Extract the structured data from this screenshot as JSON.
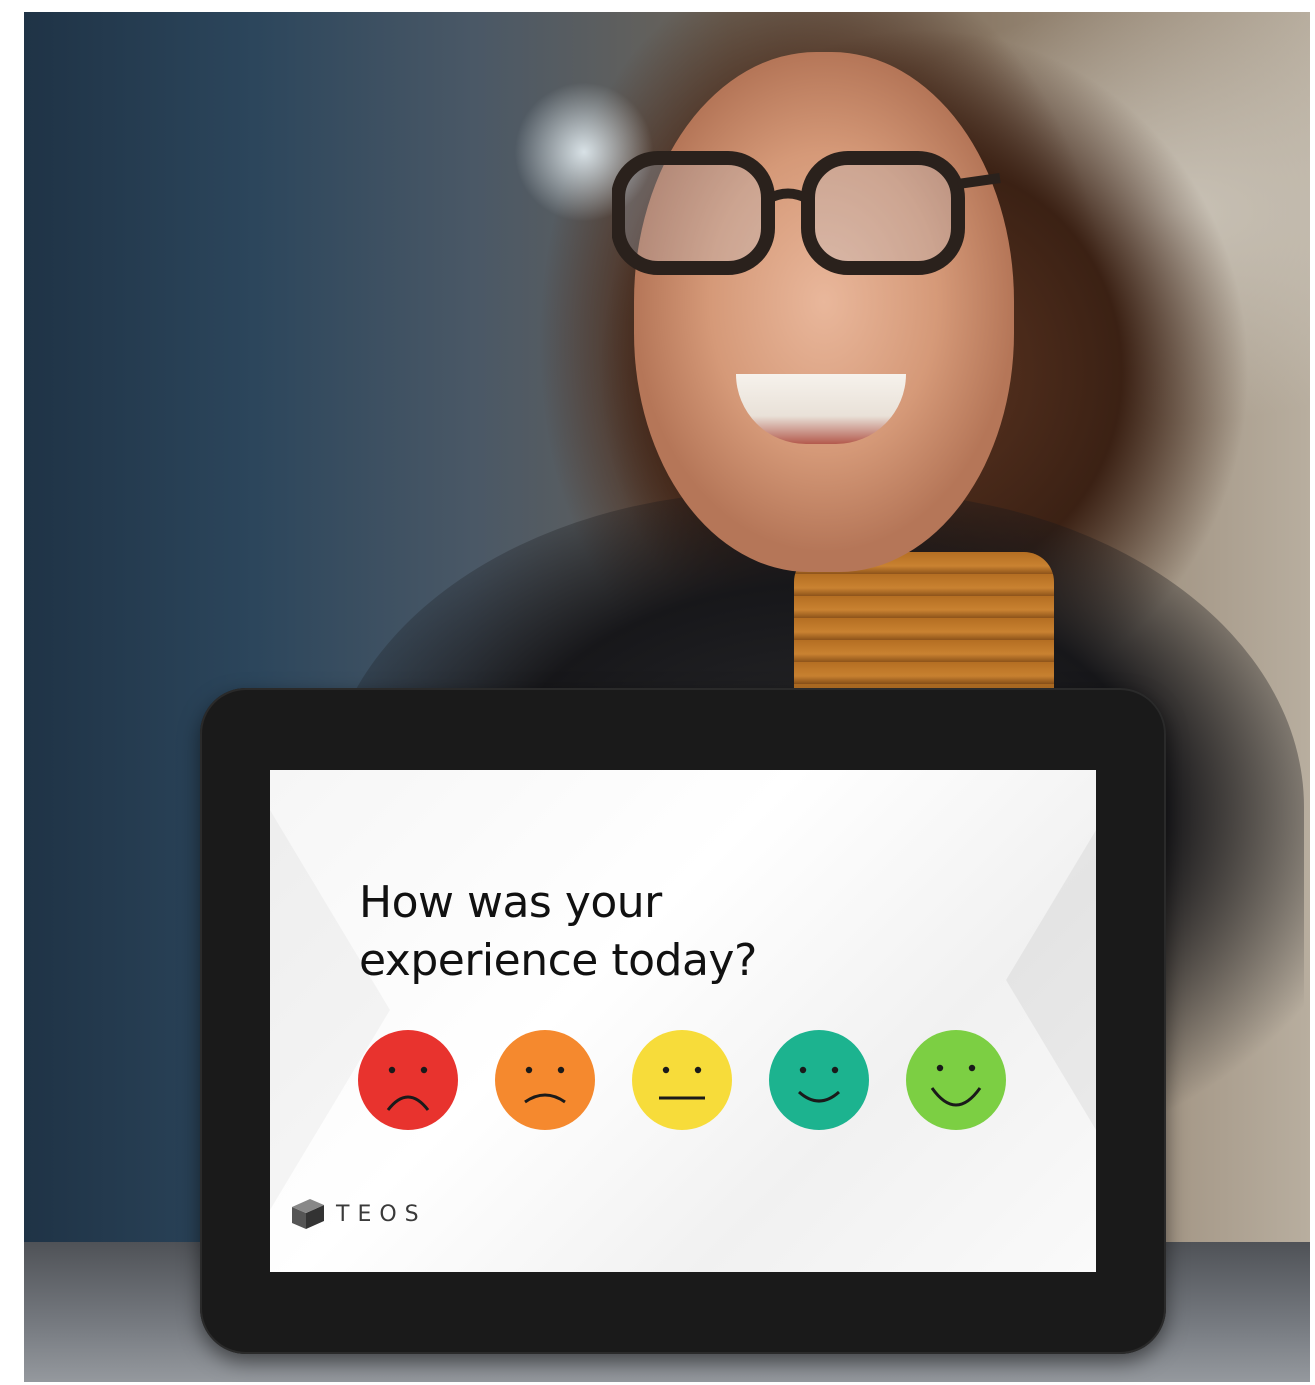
{
  "survey": {
    "question_line1": "How was your",
    "question_line2": "experience today?",
    "ratings": [
      {
        "name": "very-unhappy-face",
        "color": "#e8332e"
      },
      {
        "name": "unhappy-face",
        "color": "#f5892e"
      },
      {
        "name": "neutral-face",
        "color": "#f7dc3a"
      },
      {
        "name": "happy-face",
        "color": "#1cb38f"
      },
      {
        "name": "very-happy-face",
        "color": "#7ccf43"
      }
    ]
  },
  "brand": {
    "logo_text": "TEOS",
    "logo_icon": "teos-cube-logo"
  },
  "colors": {
    "bezel": "#1a1a1a",
    "screen_bg": "#f6f6f6",
    "text": "#111111"
  }
}
